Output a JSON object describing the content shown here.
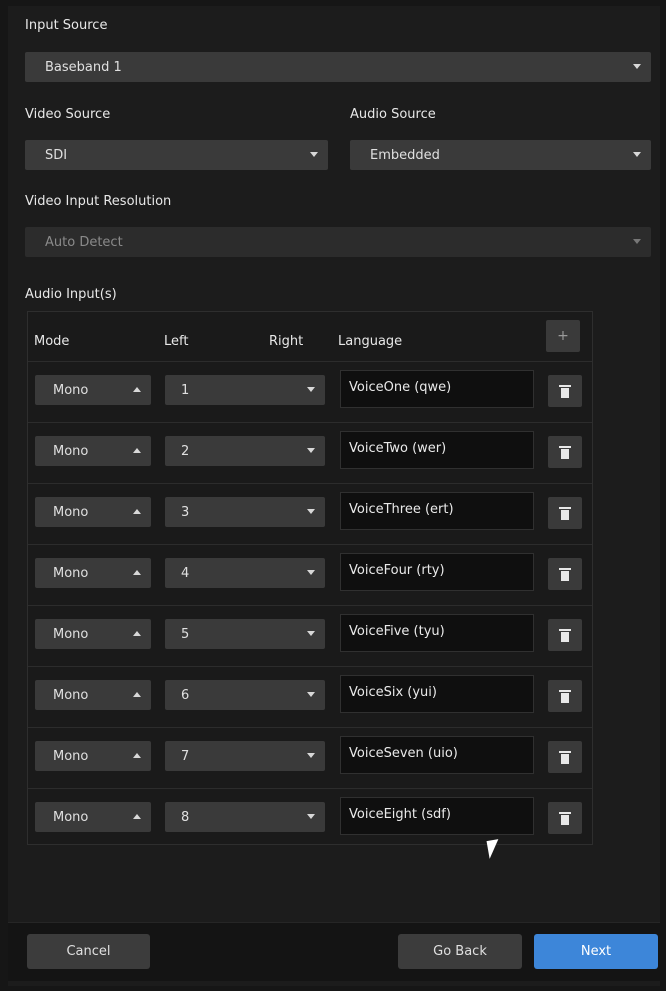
{
  "input_source": {
    "label": "Input Source",
    "value": "Baseband 1"
  },
  "video_source": {
    "label": "Video Source",
    "value": "SDI"
  },
  "audio_source": {
    "label": "Audio Source",
    "value": "Embedded"
  },
  "video_resolution": {
    "label": "Video Input Resolution",
    "value": "Auto Detect"
  },
  "audio_inputs": {
    "label": "Audio Input(s)",
    "headers": {
      "mode": "Mode",
      "left": "Left",
      "right": "Right",
      "language": "Language",
      "add": "+"
    },
    "rows": [
      {
        "mode": "Mono",
        "left": "1",
        "language": "VoiceOne (qwe)"
      },
      {
        "mode": "Mono",
        "left": "2",
        "language": "VoiceTwo (wer)"
      },
      {
        "mode": "Mono",
        "left": "3",
        "language": "VoiceThree (ert)"
      },
      {
        "mode": "Mono",
        "left": "4",
        "language": "VoiceFour (rty)"
      },
      {
        "mode": "Mono",
        "left": "5",
        "language": "VoiceFive (tyu)"
      },
      {
        "mode": "Mono",
        "left": "6",
        "language": "VoiceSix (yui)"
      },
      {
        "mode": "Mono",
        "left": "7",
        "language": "VoiceSeven (uio)"
      },
      {
        "mode": "Mono",
        "left": "8",
        "language": "VoiceEight (sdf)"
      }
    ]
  },
  "footer": {
    "cancel": "Cancel",
    "go_back": "Go Back",
    "next": "Next"
  },
  "colors": {
    "accent": "#3d86d9",
    "background": "#1c1c1c",
    "control": "#3a3a3a"
  },
  "icons": {
    "dropdown": "caret-down-icon",
    "mode_toggle": "caret-up-icon",
    "delete": "trash-icon",
    "add": "plus-icon"
  }
}
